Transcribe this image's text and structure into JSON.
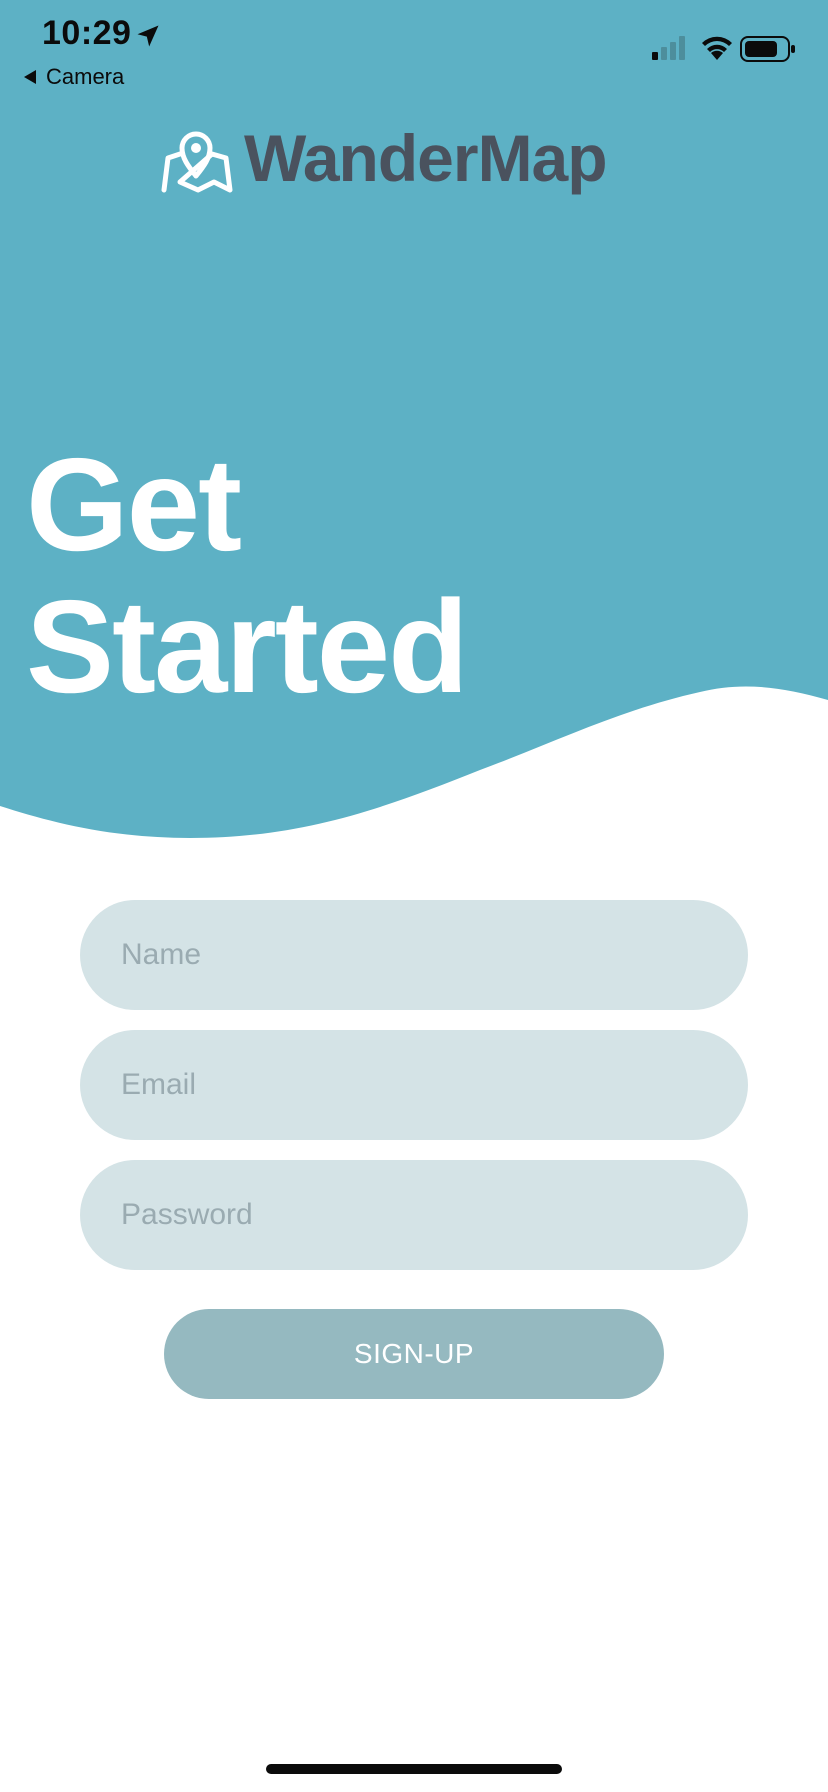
{
  "status_bar": {
    "time": "10:29",
    "back_app_label": "Camera",
    "icons": [
      "location-arrow-icon",
      "signal-icon",
      "wifi-icon",
      "battery-icon"
    ]
  },
  "brand": {
    "name": "WanderMap",
    "icon": "map-pin-icon"
  },
  "hero": {
    "headline_line1": "Get",
    "headline_line2": "Started"
  },
  "form": {
    "name_placeholder": "Name",
    "name_value": "",
    "email_placeholder": "Email",
    "email_value": "",
    "password_placeholder": "Password",
    "password_value": ""
  },
  "actions": {
    "signup_label": "SIGN-UP"
  },
  "colors": {
    "hero_bg": "#5db1c5",
    "field_bg": "#d4e3e6",
    "button_bg": "#95b9c0",
    "logo_text": "#4a525e",
    "white": "#ffffff"
  }
}
